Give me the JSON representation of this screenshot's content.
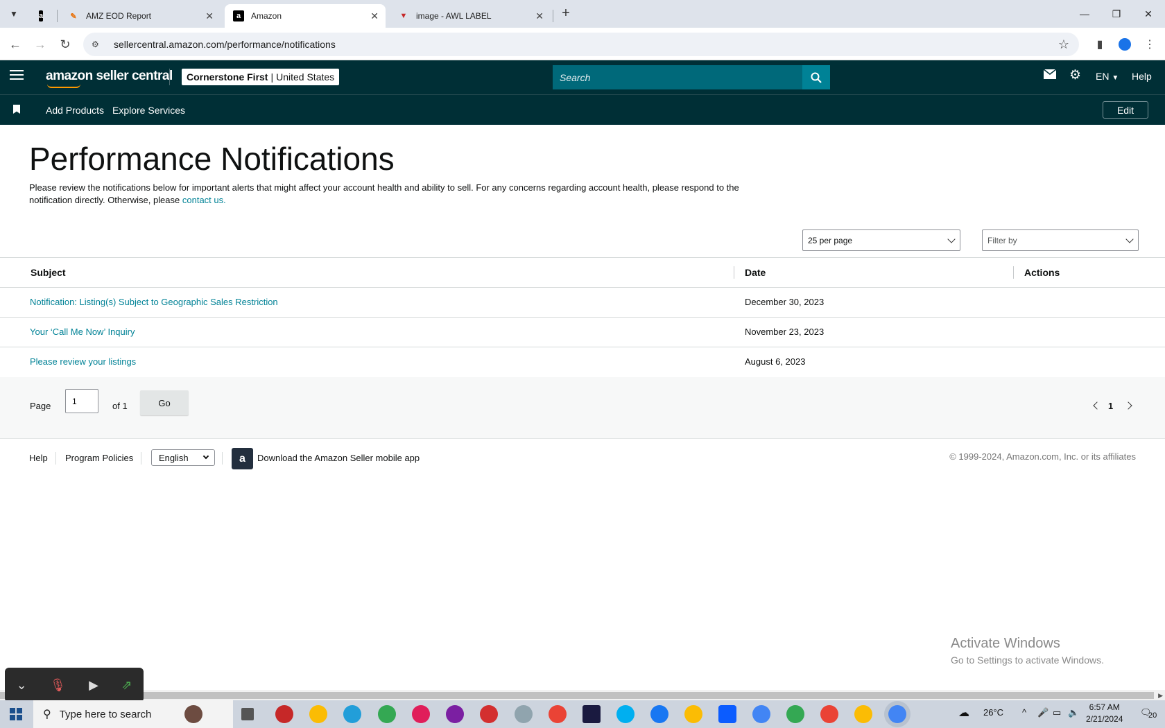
{
  "browser": {
    "tabs": [
      {
        "title": "",
        "favicon": "amazon-a"
      },
      {
        "title": "AMZ EOD Report",
        "favicon": "pencil-multicolor"
      },
      {
        "title": "Amazon",
        "favicon": "amazon-a"
      },
      {
        "title": "image - AWL LABEL",
        "favicon": "red-v"
      }
    ],
    "url": "sellercentral.amazon.com/performance/notifications"
  },
  "header": {
    "logo": "amazon seller central",
    "account_name": "Cornerstone First",
    "account_region": "United States",
    "search_placeholder": "Search",
    "language": "EN",
    "help": "Help"
  },
  "nav": {
    "links": [
      "Add Products",
      "Explore Services"
    ],
    "edit": "Edit"
  },
  "page": {
    "title": "Performance Notifications",
    "intro": "Please review the notifications below for important alerts that might affect your account health and ability to sell. For any concerns regarding account health, please respond to the notification directly. Otherwise, please",
    "contact_link": "contact us.",
    "per_page": "25 per page",
    "filter": "Filter by"
  },
  "table": {
    "columns": [
      "Subject",
      "Date",
      "Actions"
    ],
    "rows": [
      {
        "subject": "Notification: Listing(s) Subject to Geographic Sales Restriction",
        "date": "December 30, 2023"
      },
      {
        "subject": "Your ‘Call Me Now’ Inquiry",
        "date": "November 23, 2023"
      },
      {
        "subject": "Please review your listings",
        "date": "August 6, 2023"
      }
    ]
  },
  "pagination": {
    "page_label": "Page",
    "page_value": "1",
    "of_label": "of 1",
    "go": "Go",
    "current": "1"
  },
  "footer": {
    "help": "Help",
    "policies": "Program Policies",
    "language": "English",
    "app_download": "Download the Amazon Seller mobile app",
    "copyright": "© 1999-2024, Amazon.com, Inc. or its affiliates"
  },
  "watermark": {
    "line1": "Activate Windows",
    "line2": "Go to Settings to activate Windows."
  },
  "taskbar": {
    "search_placeholder": "Type here to search",
    "weather": "26°C",
    "time": "6:57 AM",
    "date": "2/21/2024",
    "notifications": "20"
  },
  "colors": {
    "header_bg": "#002f36",
    "search_bg": "#00697a",
    "link": "#008296"
  }
}
